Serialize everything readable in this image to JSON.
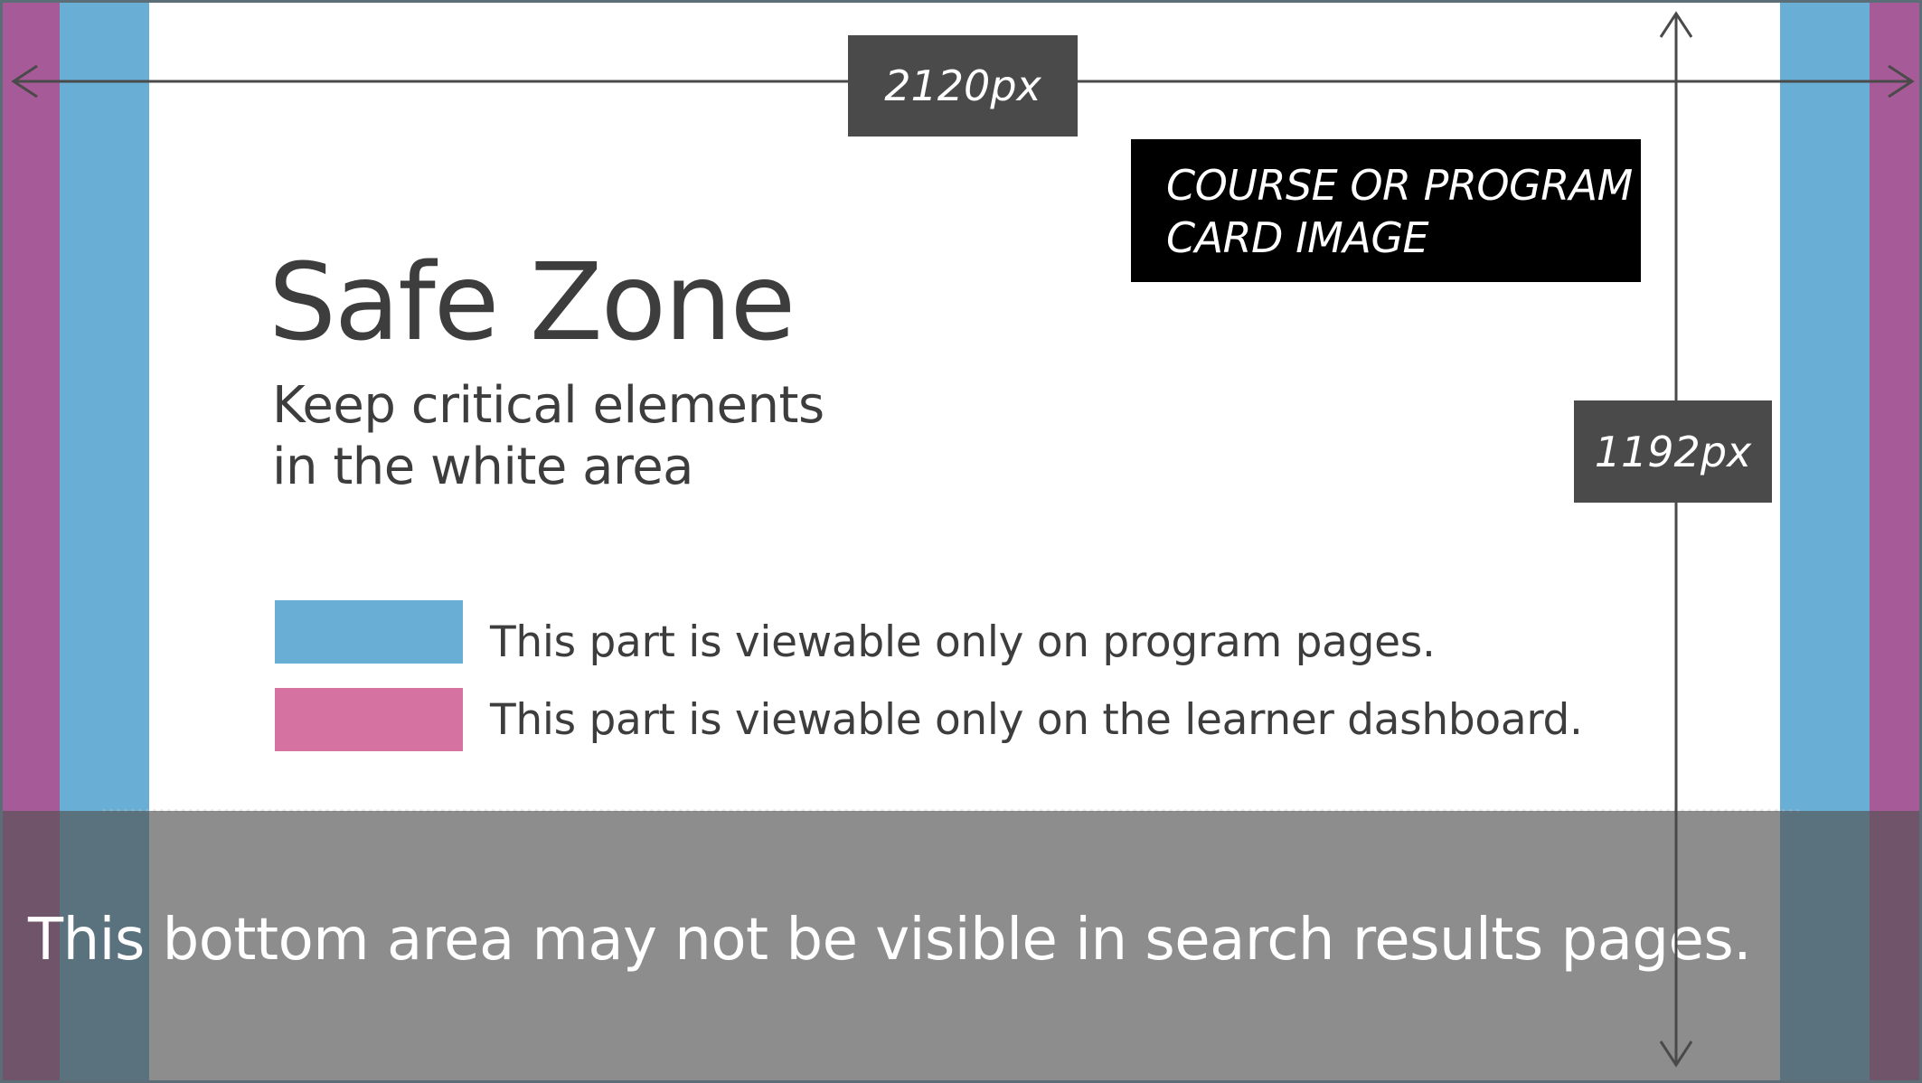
{
  "colors": {
    "program_band": "#69aed4",
    "dashboard_band": "#a75a98",
    "dashboard_swatch": "#d572a2",
    "label_bg": "#4a4a4a",
    "card_bg": "#000000",
    "text": "#3d3d3d",
    "arrow": "#4a4a4a"
  },
  "dimensions": {
    "width_label": "2120px",
    "height_label": "1192px"
  },
  "card_label": {
    "line1": "COURSE OR PROGRAM",
    "line2": "CARD IMAGE"
  },
  "safe_zone": {
    "title": "Safe Zone",
    "subtitle_line1": "Keep critical elements",
    "subtitle_line2": "in the white area"
  },
  "legend": {
    "program_pages": "This part is viewable only on program pages.",
    "learner_dashboard": "This part is viewable only on the learner dashboard."
  },
  "bottom_note": "This bottom area may not be visible in search results pages."
}
